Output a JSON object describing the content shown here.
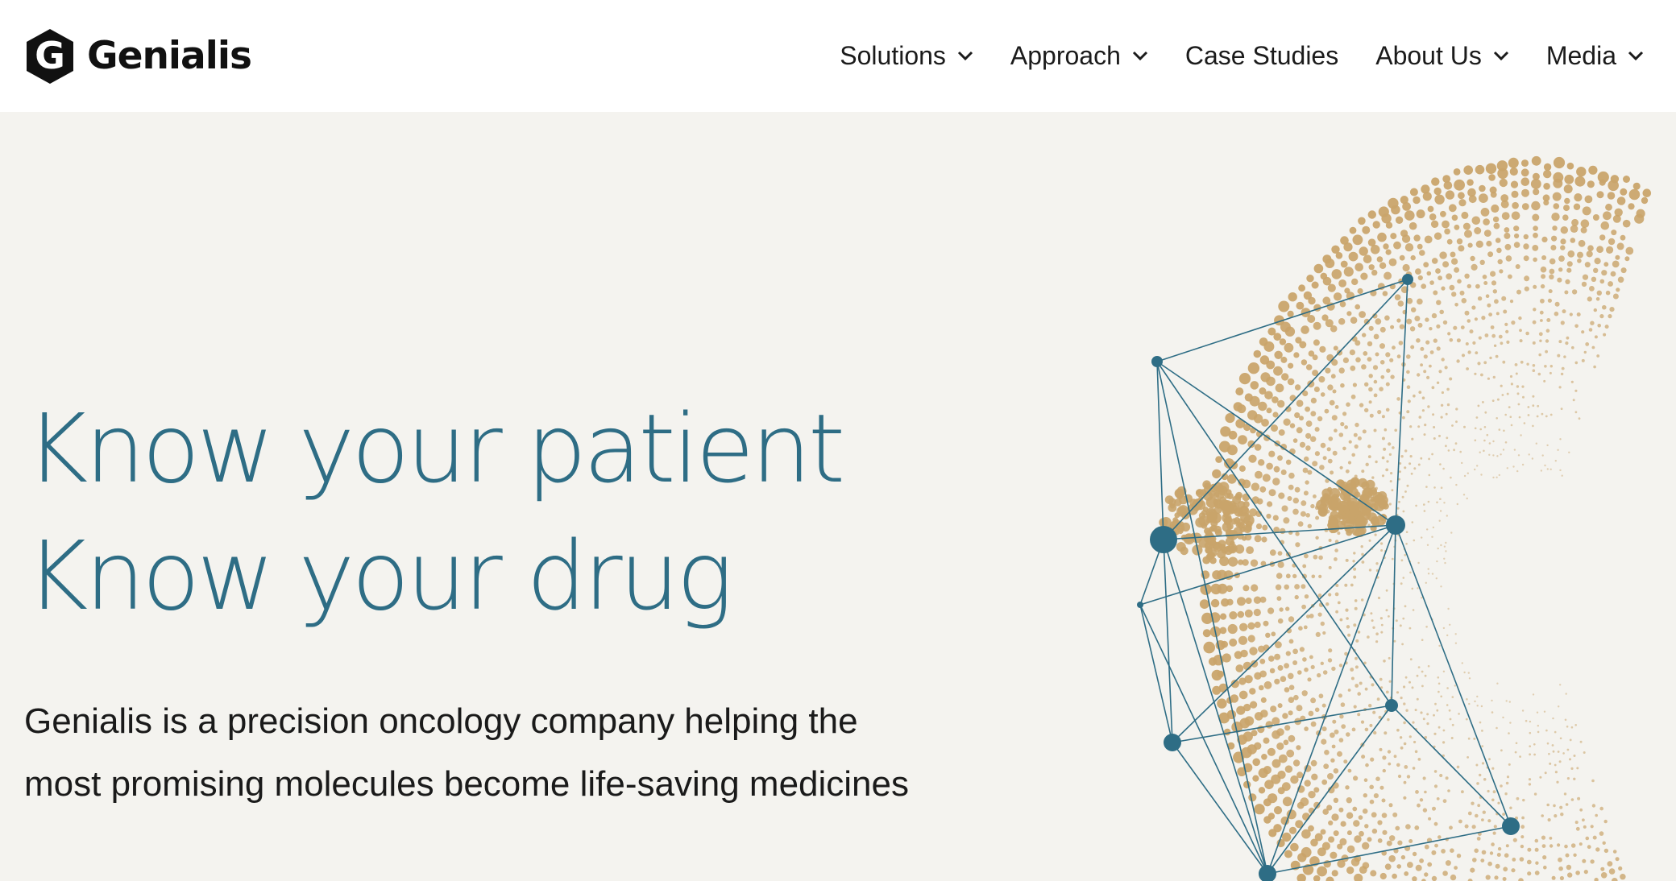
{
  "brand": {
    "name": "Genialis",
    "logo_letter": "G"
  },
  "nav": {
    "items": [
      {
        "label": "Solutions",
        "has_dropdown": true
      },
      {
        "label": "Approach",
        "has_dropdown": true
      },
      {
        "label": "Case Studies",
        "has_dropdown": false
      },
      {
        "label": "About Us",
        "has_dropdown": true
      },
      {
        "label": "Media",
        "has_dropdown": true
      }
    ]
  },
  "hero": {
    "title_line1": "Know your patient",
    "title_line2": "Know your drug",
    "subtitle_line1": "Genialis is a precision oncology company helping the",
    "subtitle_line2": "most promising molecules become life-saving medicines"
  },
  "colors": {
    "accent": "#2e6d85",
    "background": "#f4f3ef",
    "header": "#ffffff",
    "dots": "#c9a46a"
  },
  "icons": {
    "logo": "genialis-hexagon-logo-icon",
    "dropdown": "chevron-down-icon",
    "hero_art": "molecular-network-illustration"
  }
}
